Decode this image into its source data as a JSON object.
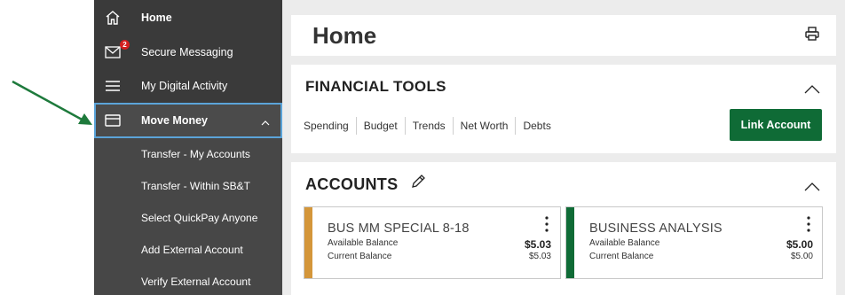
{
  "sidebar": {
    "home": "Home",
    "messaging": "Secure Messaging",
    "messaging_badge": "2",
    "activity": "My Digital Activity",
    "move_money": "Move Money",
    "sub_items": [
      "Transfer - My Accounts",
      "Transfer - Within SB&T",
      "Select QuickPay Anyone",
      "Add External Account",
      "Verify External Account"
    ]
  },
  "page": {
    "title": "Home"
  },
  "financial_tools": {
    "title": "FINANCIAL TOOLS",
    "tabs": [
      "Spending",
      "Budget",
      "Trends",
      "Net Worth",
      "Debts"
    ],
    "link_account": "Link Account"
  },
  "accounts": {
    "title": "ACCOUNTS",
    "items": [
      {
        "name": "BUS MM SPECIAL 8-18",
        "available_label": "Available Balance",
        "available": "$5.03",
        "current_label": "Current Balance",
        "current": "$5.03",
        "color": "#d4963a"
      },
      {
        "name": "BUSINESS ANALYSIS",
        "available_label": "Available Balance",
        "available": "$5.00",
        "current_label": "Current Balance",
        "current": "$5.00",
        "color": "#0f6b36"
      }
    ]
  },
  "colors": {
    "sidebar": "#3a3a3a",
    "primary_green": "#0f6b36",
    "focus_border": "#5ba4d9",
    "arrow": "#1e7a3c"
  }
}
